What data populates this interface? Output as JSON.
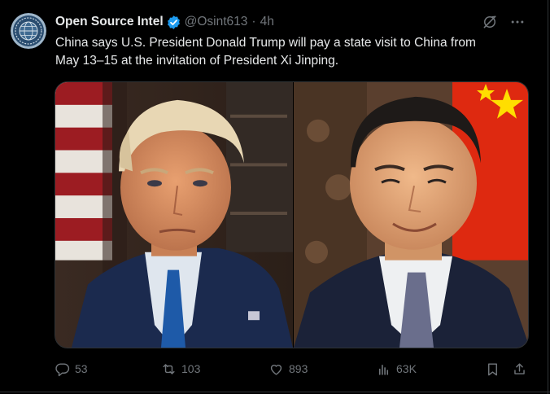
{
  "author": {
    "display_name": "Open Source Intel",
    "handle": "@Osint613",
    "separator": "·",
    "time": "4h",
    "verified": true,
    "avatar_icon": "globe-seal-icon"
  },
  "post": {
    "text": "China says U.S. President Donald Trump will pay a state visit to China from\nMay 13–15 at the invitation of President Xi Jinping."
  },
  "media": {
    "left_image": "portrait of Donald Trump",
    "right_image": "portrait of Xi Jinping"
  },
  "actions": {
    "replies": "53",
    "reposts": "103",
    "likes": "893",
    "views": "63K"
  },
  "colors": {
    "background": "#000000",
    "text": "#e7e9ea",
    "muted": "#71767b",
    "verified": "#1d9bf0",
    "border": "#2f3336"
  }
}
